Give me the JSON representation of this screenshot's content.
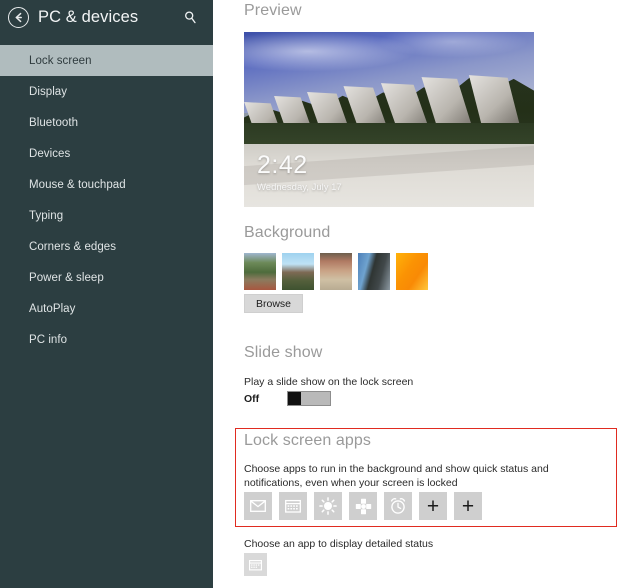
{
  "sidebar": {
    "title": "PC & devices",
    "back_icon": "back-arrow-icon",
    "search_icon": "search-icon",
    "items": [
      {
        "label": "Lock screen",
        "selected": true
      },
      {
        "label": "Display",
        "selected": false
      },
      {
        "label": "Bluetooth",
        "selected": false
      },
      {
        "label": "Devices",
        "selected": false
      },
      {
        "label": "Mouse & touchpad",
        "selected": false
      },
      {
        "label": "Typing",
        "selected": false
      },
      {
        "label": "Corners & edges",
        "selected": false
      },
      {
        "label": "Power & sleep",
        "selected": false
      },
      {
        "label": "AutoPlay",
        "selected": false
      },
      {
        "label": "PC info",
        "selected": false
      }
    ]
  },
  "preview": {
    "heading": "Preview",
    "clock": "2:42",
    "date": "Wednesday, July 17"
  },
  "background": {
    "heading": "Background",
    "browse_label": "Browse",
    "thumbnails": [
      {
        "name": "thumbnail-green-valley-village"
      },
      {
        "name": "thumbnail-blue-sky-mountain"
      },
      {
        "name": "thumbnail-warm-street-scene"
      },
      {
        "name": "thumbnail-sea-and-rock"
      },
      {
        "name": "thumbnail-orange-abstract"
      }
    ]
  },
  "slide_show": {
    "heading": "Slide show",
    "description": "Play a slide show on the lock screen",
    "state_label": "Off",
    "enabled": false
  },
  "lock_screen_apps": {
    "heading": "Lock screen apps",
    "description": "Choose apps to run in the background and show quick status and notifications, even when your screen is locked",
    "highlight_color": "#e02b20",
    "tiles": [
      {
        "name": "mail-icon",
        "label": "Mail"
      },
      {
        "name": "calendar-icon",
        "label": "Calendar"
      },
      {
        "name": "weather-icon",
        "label": "Weather"
      },
      {
        "name": "messaging-icon",
        "label": "Messaging"
      },
      {
        "name": "alarm-clock-icon",
        "label": "Alarms"
      },
      {
        "name": "add-app-icon",
        "label": "+"
      },
      {
        "name": "add-app-icon",
        "label": "+"
      }
    ]
  },
  "detailed_status": {
    "description": "Choose an app to display detailed status",
    "tile": {
      "name": "calendar-icon",
      "label": "Calendar"
    }
  },
  "colors": {
    "sidebar_bg": "#2c3e41",
    "sidebar_selected_bg": "#b0bcbe",
    "content_bg": "#ffffff",
    "heading_text": "#9a9a9a",
    "body_text": "#2b2b2b",
    "tile_bg": "#cfcfcf",
    "highlight": "#e02b20"
  }
}
